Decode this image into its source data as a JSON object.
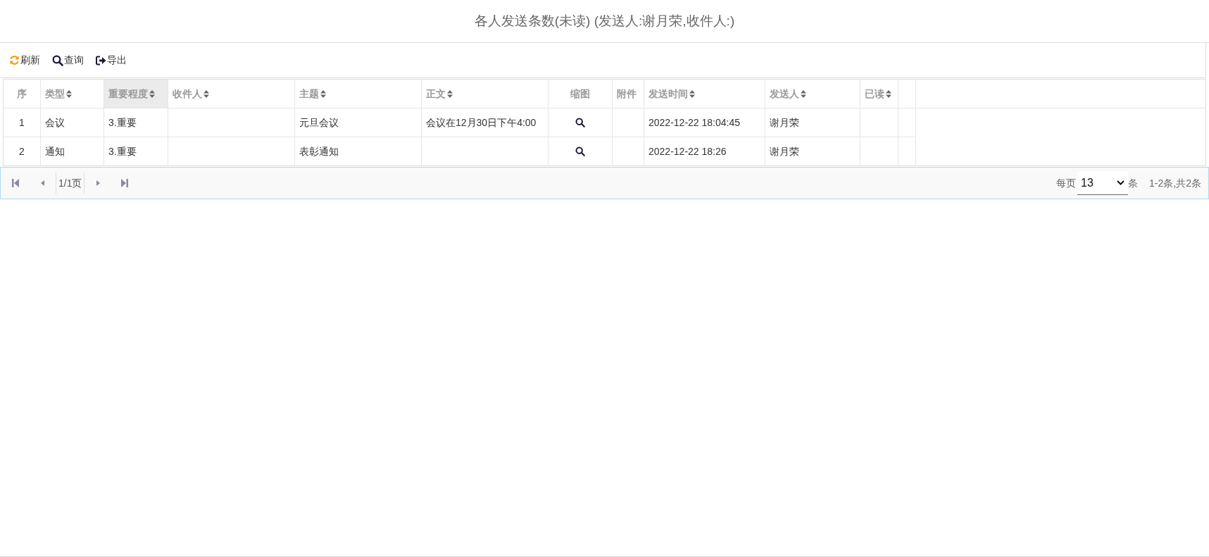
{
  "title": "各人发送条数(未读) (发送人:谢月荣,收件人:)",
  "toolbar": [
    {
      "kind": "refresh",
      "label": "刷新"
    },
    {
      "kind": "search",
      "label": "查询"
    },
    {
      "kind": "export",
      "label": "导出"
    }
  ],
  "table": {
    "columns": [
      {
        "label": "序",
        "sortable": false,
        "highlighted": false
      },
      {
        "label": "类型",
        "sortable": true,
        "highlighted": false
      },
      {
        "label": "重要程度",
        "sortable": true,
        "highlighted": true
      },
      {
        "label": "收件人",
        "sortable": true,
        "highlighted": false
      },
      {
        "label": "主题",
        "sortable": true,
        "highlighted": false
      },
      {
        "label": "正文",
        "sortable": true,
        "highlighted": false
      },
      {
        "label": "缩图",
        "sortable": false,
        "highlighted": false
      },
      {
        "label": "附件",
        "sortable": false,
        "highlighted": false
      },
      {
        "label": "发送时间",
        "sortable": true,
        "highlighted": false
      },
      {
        "label": "发送人",
        "sortable": true,
        "highlighted": false
      },
      {
        "label": "已读",
        "sortable": true,
        "highlighted": false
      }
    ],
    "rows": [
      {
        "index": "1",
        "type": "会议",
        "importance": "3.重要",
        "subject": "元旦会议",
        "body": "会议在12月30日下午4:00",
        "sent_time": "2022-12-22 18:04:45",
        "sender": "谢月荣"
      },
      {
        "index": "2",
        "type": "通知",
        "importance": "3.重要",
        "subject": "表彰通知",
        "sent_time": "2022-12-22 18:26",
        "sender": "谢月荣"
      }
    ]
  },
  "pager": {
    "page": "1/1页",
    "per_page_label": "每页",
    "per_page": "13",
    "unit": "条",
    "summary": "1-2条,共2条"
  }
}
